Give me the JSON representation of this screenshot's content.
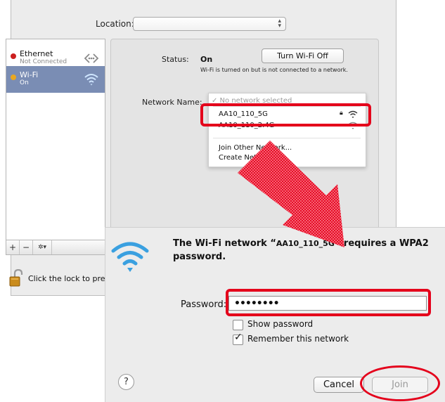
{
  "network_window": {
    "location_label": "Location:",
    "location_value": "",
    "services": [
      {
        "name": "Ethernet",
        "status": "Not Connected",
        "dot_color": "#cc1f1f",
        "icon": "ethernet-arrows-icon"
      },
      {
        "name": "Wi-Fi",
        "status": "On",
        "dot_color": "#e9a720",
        "icon": "wifi-icon"
      }
    ],
    "toolbar": {
      "add": "+",
      "remove": "−",
      "action": "✲▾"
    },
    "lock_text": "Click the lock to prev",
    "status_label": "Status:",
    "status_value": "On",
    "turn_off_label": "Turn Wi-Fi Off",
    "status_description": "Wi-Fi is turned on but is not connected to a network.",
    "network_name_label": "Network Name:",
    "dropdown": {
      "none_selected": "✓ No network selected",
      "networks": [
        "AA10_110_5G",
        "AA10_110_2.4G"
      ],
      "join_other": "Join Other Network...",
      "create_network": "Create Network..."
    }
  },
  "join_dialog": {
    "title_prefix": "The Wi-Fi network “",
    "network": "AA10_110_5G",
    "title_suffix": "” requires a WPA2 password.",
    "password_label": "Password:",
    "password_value": "••••••••",
    "show_password_label": "Show password",
    "show_password_checked": false,
    "remember_label": "Remember this network",
    "remember_checked": true,
    "help_label": "?",
    "cancel_label": "Cancel",
    "join_label": "Join"
  },
  "colors": {
    "highlight": "#e4001b",
    "selection": "#7a8db4",
    "wifi_blue": "#3aa0e0"
  }
}
